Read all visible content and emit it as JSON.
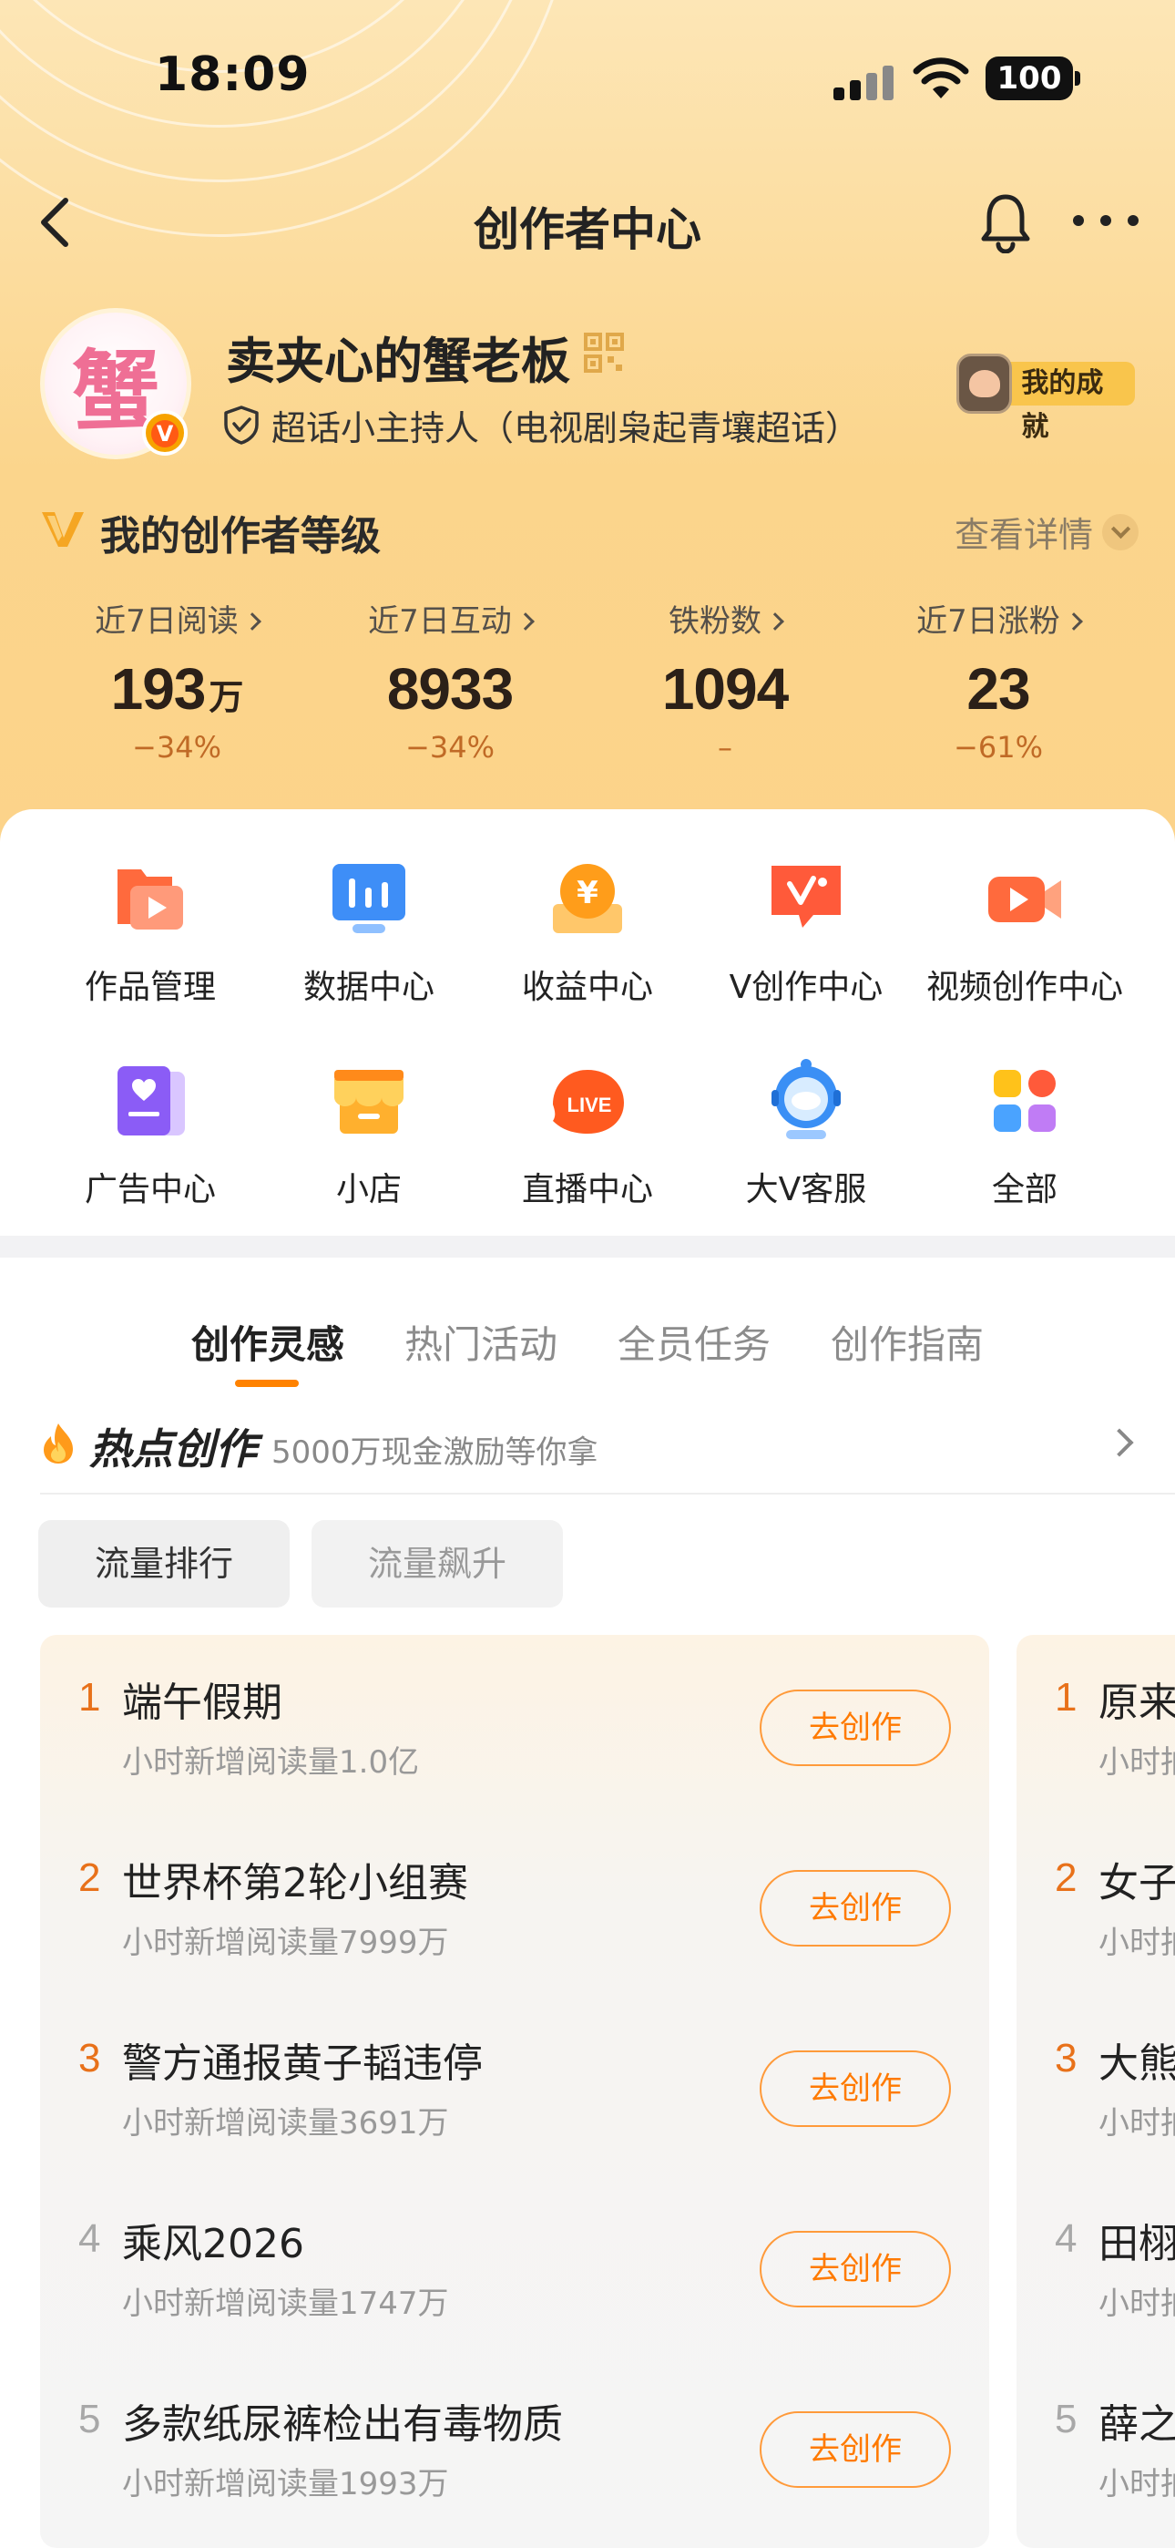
{
  "status_bar": {
    "time": "18:09",
    "battery": "100"
  },
  "nav": {
    "title": "创作者中心"
  },
  "profile": {
    "avatar_char": "蟹",
    "nickname": "卖夹心的蟹老板",
    "role": "超话小主持人（电视剧枭起青壤超话）",
    "achievement_label": "我的成就"
  },
  "level": {
    "title": "我的创作者等级",
    "detail": "查看详情"
  },
  "stats": [
    {
      "label": "近7日阅读",
      "value": "193",
      "unit": "万",
      "change": "−34%"
    },
    {
      "label": "近7日互动",
      "value": "8933",
      "unit": "",
      "change": "−34%"
    },
    {
      "label": "铁粉数",
      "value": "1094",
      "unit": "",
      "change": "–"
    },
    {
      "label": "近7日涨粉",
      "value": "23",
      "unit": "",
      "change": "−61%"
    }
  ],
  "tools": [
    {
      "label": "作品管理",
      "icon": "folder-play-icon"
    },
    {
      "label": "数据中心",
      "icon": "bar-chart-icon"
    },
    {
      "label": "收益中心",
      "icon": "coin-icon"
    },
    {
      "label": "V创作中心",
      "icon": "v-create-icon"
    },
    {
      "label": "视频创作中心",
      "icon": "video-camera-icon"
    },
    {
      "label": "广告中心",
      "icon": "ad-book-icon"
    },
    {
      "label": "小店",
      "icon": "shop-icon"
    },
    {
      "label": "直播中心",
      "icon": "live-icon"
    },
    {
      "label": "大V客服",
      "icon": "astronaut-service-icon"
    },
    {
      "label": "全部",
      "icon": "all-grid-icon"
    }
  ],
  "tabs": [
    "创作灵感",
    "热门活动",
    "全员任务",
    "创作指南"
  ],
  "hot": {
    "title": "热点创作",
    "subtitle": "5000万现金激励等你拿"
  },
  "pills": [
    "流量排行",
    "流量飙升"
  ],
  "ranking": [
    {
      "rank": "1",
      "title": "端午假期",
      "sub": "小时新增阅读量1.0亿",
      "action": "去创作"
    },
    {
      "rank": "2",
      "title": "世界杯第2轮小组赛",
      "sub": "小时新增阅读量7999万",
      "action": "去创作"
    },
    {
      "rank": "3",
      "title": "警方通报黄子韬违停",
      "sub": "小时新增阅读量3691万",
      "action": "去创作"
    },
    {
      "rank": "4",
      "title": "乘风2026",
      "sub": "小时新增阅读量1747万",
      "action": "去创作"
    },
    {
      "rank": "5",
      "title": "多款纸尿裤检出有毒物质",
      "sub": "小时新增阅读量1993万",
      "action": "去创作"
    }
  ],
  "ranking2": [
    {
      "rank": "1",
      "title": "原来",
      "sub": "小时拍"
    },
    {
      "rank": "2",
      "title": "女子",
      "sub": "小时拍"
    },
    {
      "rank": "3",
      "title": "大熊",
      "sub": "小时拍"
    },
    {
      "rank": "4",
      "title": "田栩",
      "sub": "小时拍"
    },
    {
      "rank": "5",
      "title": "薛之",
      "sub": "小时拍"
    }
  ],
  "colors": {
    "accent": "#ff8200",
    "rank_top": "#e8711a",
    "rank_other": "#a8a8a8"
  }
}
